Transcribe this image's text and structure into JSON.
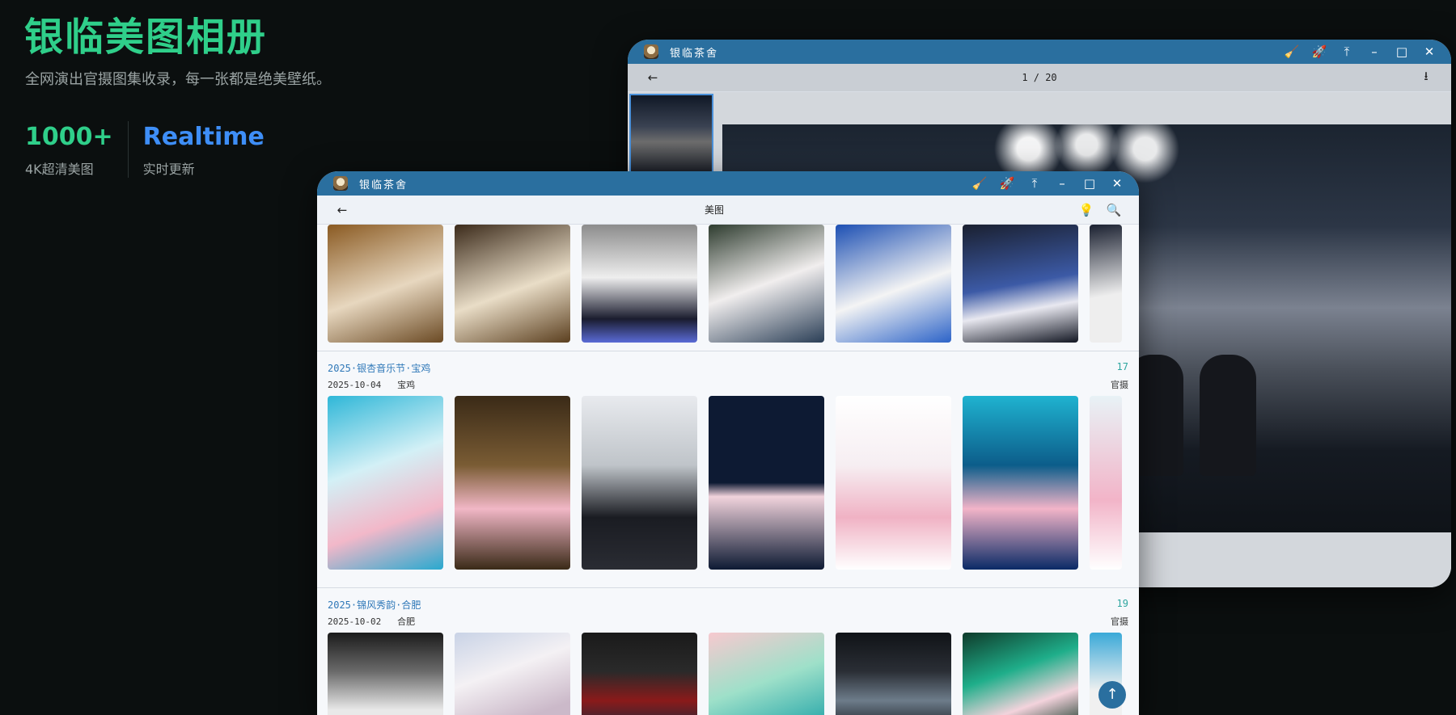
{
  "hero": {
    "title": "银临美图相册",
    "subtitle": "全网演出官摄图集收录，每一张都是绝美壁纸。",
    "stats": [
      {
        "value": "1000+",
        "label": "4K超清美图"
      },
      {
        "value": "Realtime",
        "label": "实时更新"
      }
    ]
  },
  "viewer_window": {
    "app_title": "银临茶舍",
    "page_indicator": "1 / 20"
  },
  "gallery_window": {
    "app_title": "银临茶舍",
    "page_title": "美图",
    "albums": [
      {
        "title": "2025·银杏音乐节·宝鸡",
        "date": "2025-10-04",
        "city": "宝鸡",
        "count": "17",
        "tag": "官摄"
      },
      {
        "title": "2025·锦风秀韵·合肥",
        "date": "2025-10-02",
        "city": "合肥",
        "count": "19",
        "tag": "官摄"
      }
    ]
  },
  "icons": {
    "back": "arrow-left-icon",
    "download": "download-icon",
    "broom": "broom-icon",
    "rocket": "rocket-icon",
    "top": "arrow-up-bar-icon",
    "minimize": "minimize-icon",
    "maximize": "maximize-icon",
    "close": "close-icon",
    "lightbulb": "lightbulb-icon",
    "search": "search-icon"
  },
  "colors": {
    "accent_green": "#2fcf8a",
    "accent_blue": "#3e8ef7",
    "titlebar": "#2a6f9f"
  }
}
